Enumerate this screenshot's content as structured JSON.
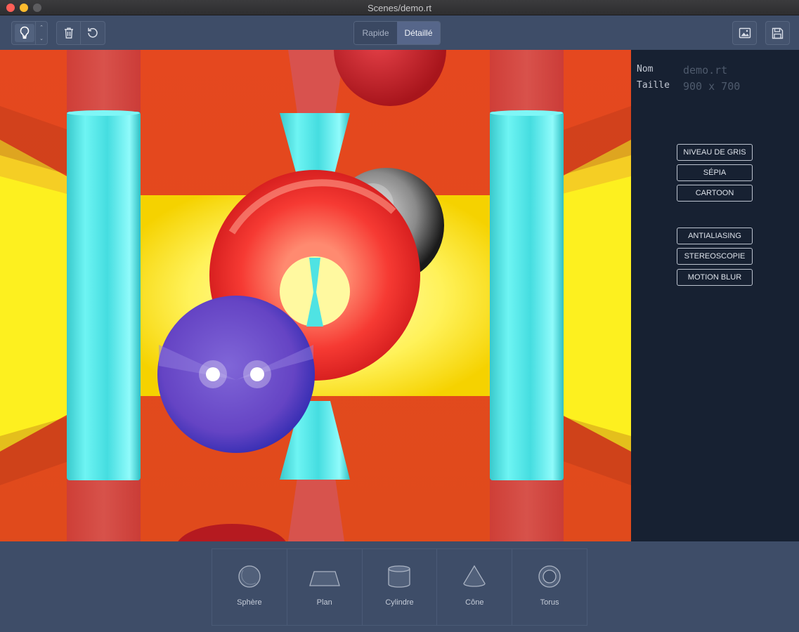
{
  "window": {
    "title": "Scenes/demo.rt"
  },
  "toolbar": {
    "light_icon": "lightbulb-icon",
    "stepper_up": "⌃",
    "stepper_down": "⌄",
    "trash_icon": "trash-icon",
    "undo_icon": "rotate-ccw-icon",
    "mode_options": [
      "Rapide",
      "Détaillé"
    ],
    "mode_selected": "Détaillé",
    "image_icon": "image-icon",
    "save_icon": "save-icon"
  },
  "info": {
    "name_label": "Nom",
    "name_value": "demo.rt",
    "size_label": "Taille",
    "size_value": "900 x 700"
  },
  "filters": [
    "NIVEAU DE GRIS",
    "SÉPIA",
    "CARTOON"
  ],
  "effects": [
    "ANTIALIASING",
    "STEREOSCOPIE",
    "MOTION BLUR"
  ],
  "shapes": [
    {
      "label": "Sphère",
      "icon": "sphere-icon"
    },
    {
      "label": "Plan",
      "icon": "plane-icon"
    },
    {
      "label": "Cylindre",
      "icon": "cylinder-icon"
    },
    {
      "label": "Cône",
      "icon": "cone-icon"
    },
    {
      "label": "Torus",
      "icon": "torus-icon"
    }
  ],
  "colors": {
    "accent_selected": "#56668a",
    "panel_bg": "#172132",
    "toolbar_bg": "#3e4d68"
  }
}
